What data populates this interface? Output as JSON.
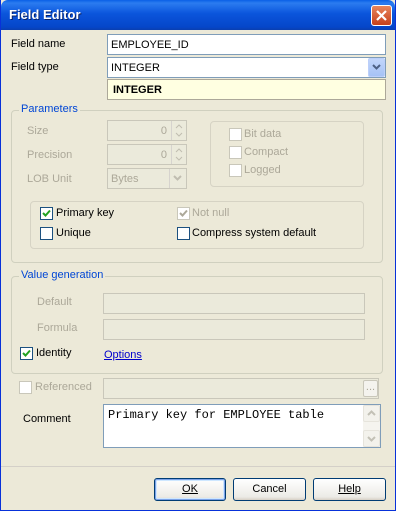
{
  "window": {
    "title": "Field Editor",
    "close_icon": "close-icon",
    "accent": "#0a58e4"
  },
  "field": {
    "name_label": "Field name",
    "name_value": "EMPLOYEE_ID",
    "type_label": "Field type",
    "type_value": "INTEGER",
    "type_display": "INTEGER"
  },
  "parameters": {
    "title": "Parameters",
    "size_label": "Size",
    "size_value": "0",
    "precision_label": "Precision",
    "precision_value": "0",
    "lob_label": "LOB Unit",
    "lob_value": "Bytes",
    "bit_data": {
      "label": "Bit data",
      "checked": false
    },
    "compact": {
      "label": "Compact",
      "checked": false
    },
    "logged": {
      "label": "Logged",
      "checked": false
    },
    "primary_key": {
      "label": "Primary key",
      "checked": true
    },
    "not_null": {
      "label": "Not null",
      "checked": true
    },
    "unique": {
      "label": "Unique",
      "checked": false
    },
    "compress": {
      "label": "Compress system default",
      "checked": false
    }
  },
  "value_generation": {
    "title": "Value generation",
    "default_label": "Default",
    "default_value": "",
    "formula_label": "Formula",
    "formula_value": "",
    "identity": {
      "label": "Identity",
      "checked": true
    },
    "options_link": "Options"
  },
  "referenced": {
    "label": "Referenced",
    "checked": false,
    "value": "",
    "ellipsis": "..."
  },
  "comment": {
    "label": "Comment",
    "value": "Primary key for EMPLOYEE table"
  },
  "buttons": {
    "ok": "OK",
    "cancel": "Cancel",
    "help": "Help"
  }
}
